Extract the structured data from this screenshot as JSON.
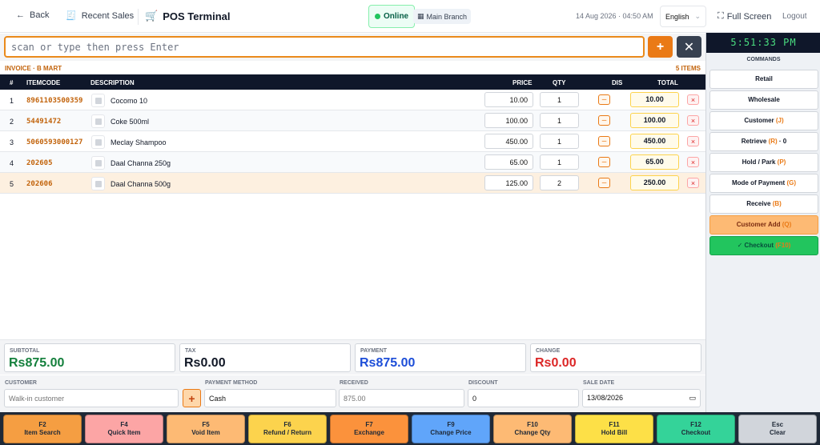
{
  "topbar": {
    "back_label": "Back",
    "recent_label": "Recent Sales",
    "title": "POS Terminal",
    "status": "Online",
    "branch": "Main Branch",
    "datetime": "14 Aug 2026 · 04:50 AM",
    "language": "English",
    "fullscreen_label": "Full Screen",
    "logout_label": "Logout"
  },
  "scan": {
    "placeholder": "scan or type then press Enter",
    "add_label": "+",
    "clear_label": "✕"
  },
  "invoice": {
    "label": "INVOICE · B MART",
    "count": "5 ITEMS"
  },
  "table": {
    "headers": {
      "num": "#",
      "code": "ITEMCODE",
      "desc": "DESCRIPTION",
      "price": "PRICE",
      "qty": "QTY",
      "dis": "DIS",
      "total": "TOTAL"
    },
    "dis_label": "–",
    "del_label": "×",
    "rows": [
      {
        "num": "1",
        "code": "8961103500359",
        "desc": "Cocomo 10",
        "price": "10.00",
        "qty": "1",
        "total": "10.00"
      },
      {
        "num": "2",
        "code": "54491472",
        "desc": "Coke 500ml",
        "price": "100.00",
        "qty": "1",
        "total": "100.00"
      },
      {
        "num": "3",
        "code": "5060593000127",
        "desc": "Meclay Shampoo",
        "price": "450.00",
        "qty": "1",
        "total": "450.00"
      },
      {
        "num": "4",
        "code": "202605",
        "desc": "Daal Channa 250g",
        "price": "65.00",
        "qty": "1",
        "total": "65.00"
      },
      {
        "num": "5",
        "code": "202606",
        "desc": "Daal Channa 500g",
        "price": "125.00",
        "qty": "2",
        "total": "250.00"
      }
    ]
  },
  "summary": {
    "subtotal": {
      "label": "SUBTOTAL",
      "value": "Rs875.00",
      "color": "#15803d"
    },
    "tax": {
      "label": "TAX",
      "value": "Rs0.00",
      "color": "#111827"
    },
    "payment": {
      "label": "PAYMENT",
      "value": "Rs875.00",
      "color": "#1d4ed8"
    },
    "change": {
      "label": "CHANGE",
      "value": "Rs0.00",
      "color": "#dc2626"
    }
  },
  "fields": {
    "customer": {
      "label": "CUSTOMER",
      "placeholder": "Walk-in customer",
      "add_label": "+"
    },
    "payment_method": {
      "label": "PAYMENT METHOD",
      "value": "Cash"
    },
    "received": {
      "label": "RECEIVED",
      "placeholder": "875.00"
    },
    "discount": {
      "label": "DISCOUNT",
      "value": "0"
    },
    "sale_date": {
      "label": "SALE DATE",
      "value": "13/08/2026"
    }
  },
  "right_panel": {
    "clock": "5:51:33 PM",
    "commands_title": "COMMANDS",
    "commands": [
      {
        "label": "Retail",
        "key": ""
      },
      {
        "label": "Wholesale",
        "key": ""
      },
      {
        "label": "Customer",
        "key": "(J)"
      },
      {
        "label": "Retrieve",
        "key": "(R)",
        "extra": "· 0"
      },
      {
        "label": "Hold / Park",
        "key": "(P)"
      },
      {
        "label": "Mode of Payment",
        "key": "(G)"
      },
      {
        "label": "Receive",
        "key": "(B)"
      },
      {
        "label": "Customer Add",
        "key": "(Q)"
      },
      {
        "label": "✓ Checkout",
        "key": "(F10)"
      }
    ]
  },
  "fkeys": [
    {
      "key": "F2",
      "label": "Item Search",
      "color": "#f59e42"
    },
    {
      "key": "F4",
      "label": "Quick Item",
      "color": "#fca5a5"
    },
    {
      "key": "F5",
      "label": "Void Item",
      "color": "#fdba74"
    },
    {
      "key": "F6",
      "label": "Refund / Return",
      "color": "#fcd34d"
    },
    {
      "key": "F7",
      "label": "Exchange",
      "color": "#fb923c"
    },
    {
      "key": "F9",
      "label": "Change Price",
      "color": "#60a5fa"
    },
    {
      "key": "F10",
      "label": "Change Qty",
      "color": "#fdba74"
    },
    {
      "key": "F11",
      "label": "Hold Bill",
      "color": "#fde047"
    },
    {
      "key": "F12",
      "label": "Checkout",
      "color": "#34d399"
    },
    {
      "key": "Esc",
      "label": "Clear",
      "color": "#d1d5db"
    }
  ]
}
